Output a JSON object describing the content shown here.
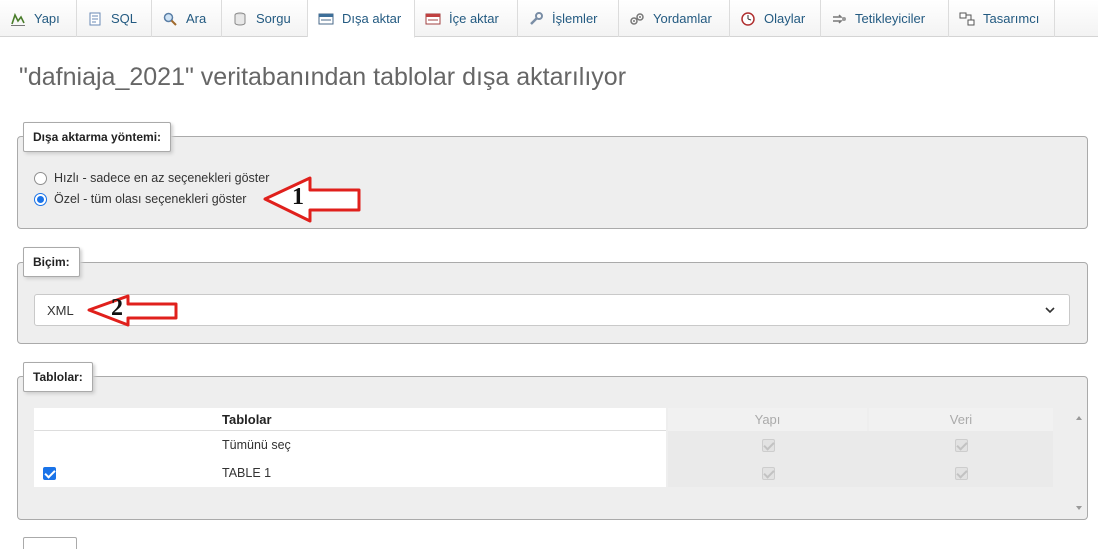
{
  "tabs": [
    {
      "label": "Yapı",
      "icon": "structure-icon"
    },
    {
      "label": "SQL",
      "icon": "sql-icon"
    },
    {
      "label": "Ara",
      "icon": "search-icon"
    },
    {
      "label": "Sorgu",
      "icon": "query-icon"
    },
    {
      "label": "Dışa aktar",
      "icon": "export-icon",
      "active": true
    },
    {
      "label": "İçe aktar",
      "icon": "import-icon"
    },
    {
      "label": "İşlemler",
      "icon": "wrench-icon"
    },
    {
      "label": "Yordamlar",
      "icon": "routines-icon"
    },
    {
      "label": "Olaylar",
      "icon": "clock-icon"
    },
    {
      "label": "Tetikleyiciler",
      "icon": "triggers-icon"
    },
    {
      "label": "Tasarımcı",
      "icon": "designer-icon"
    }
  ],
  "page": {
    "title": "\"dafniaja_2021\" veritabanından tablolar dışa aktarılıyor"
  },
  "export_method": {
    "legend": "Dışa aktarma yöntemi:",
    "options": [
      {
        "label": "Hızlı - sadece en az seçenekleri göster",
        "selected": false
      },
      {
        "label": "Özel - tüm olası seçenekleri göster",
        "selected": true
      }
    ]
  },
  "format": {
    "legend": "Biçim:",
    "selected": "XML"
  },
  "tables": {
    "legend": "Tablolar:",
    "headers": [
      "Tablolar",
      "Yapı",
      "Veri"
    ],
    "rows": [
      {
        "name": "Tümünü seç",
        "checked": null,
        "structure": true,
        "data": true
      },
      {
        "name": "TABLE 1",
        "checked": true,
        "structure": true,
        "data": true
      }
    ]
  },
  "annotations": {
    "marker1": "1",
    "marker2": "2",
    "arrow_color": "#e0201c"
  },
  "colors": {
    "link": "#235a81",
    "fieldset_bg": "#eeeeee",
    "accent": "#1a73e8"
  }
}
